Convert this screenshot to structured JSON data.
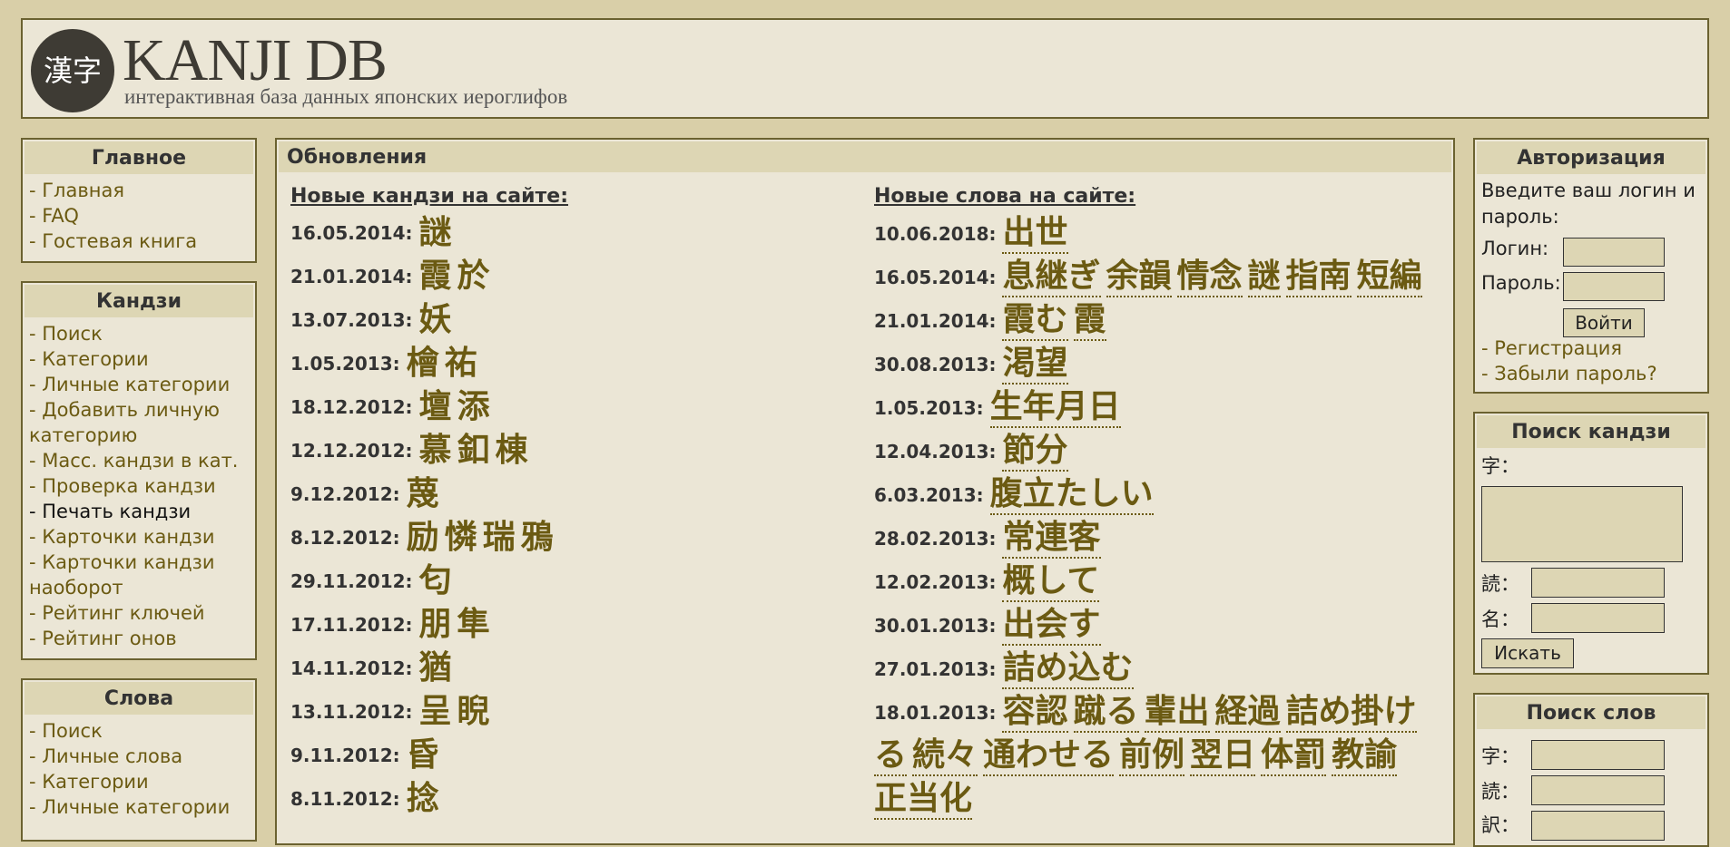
{
  "header": {
    "logo_glyph": "漢字",
    "title": "KANJI DB",
    "subtitle": "интерактивная база данных японских иероглифов"
  },
  "sidebar": {
    "main": {
      "title": "Главное",
      "items": [
        "- Главная",
        "- FAQ",
        "- Гостевая книга"
      ]
    },
    "kanji": {
      "title": "Кандзи",
      "items": [
        "- Поиск",
        "- Категории",
        "- Личные категории",
        "- Добавить личную категорию",
        "- Масс. кандзи в кат.",
        "- Проверка кандзи",
        "- Печать кандзи",
        "- Карточки кандзи",
        "- Карточки кандзи наоборот",
        "- Рейтинг ключей",
        "- Рейтинг онов"
      ]
    },
    "words": {
      "title": "Слова",
      "items": [
        "- Поиск",
        "- Личные слова",
        "- Категории",
        "- Личные категории"
      ]
    }
  },
  "main": {
    "title": "Обновления",
    "kanji_title": "Новые кандзи на сайте:",
    "words_title": "Новые слова на сайте:",
    "kanji_rows": [
      {
        "date": "16.05.2014:",
        "items": [
          "謎"
        ]
      },
      {
        "date": "21.01.2014:",
        "items": [
          "霞",
          "於"
        ]
      },
      {
        "date": "13.07.2013:",
        "items": [
          "妖"
        ]
      },
      {
        "date": "1.05.2013:",
        "items": [
          "檜",
          "祐"
        ]
      },
      {
        "date": "18.12.2012:",
        "items": [
          "壇",
          "添"
        ]
      },
      {
        "date": "12.12.2012:",
        "items": [
          "慕",
          "釦",
          "棟"
        ]
      },
      {
        "date": "9.12.2012:",
        "items": [
          "蔑"
        ]
      },
      {
        "date": "8.12.2012:",
        "items": [
          "励",
          "憐",
          "瑞",
          "鴉"
        ]
      },
      {
        "date": "29.11.2012:",
        "items": [
          "匂"
        ]
      },
      {
        "date": "17.11.2012:",
        "items": [
          "朋",
          "隼"
        ]
      },
      {
        "date": "14.11.2012:",
        "items": [
          "猶"
        ]
      },
      {
        "date": "13.11.2012:",
        "items": [
          "呈",
          "睨"
        ]
      },
      {
        "date": "9.11.2012:",
        "items": [
          "昏"
        ]
      },
      {
        "date": "8.11.2012:",
        "items": [
          "捻"
        ]
      }
    ],
    "word_rows": [
      {
        "date": "10.06.2018:",
        "items": [
          "出世"
        ]
      },
      {
        "date": "16.05.2014:",
        "items": [
          "息継ぎ",
          "余韻",
          "情念",
          "謎",
          "指南",
          "短編"
        ]
      },
      {
        "date": "21.01.2014:",
        "items": [
          "霞む",
          "霞"
        ]
      },
      {
        "date": "30.08.2013:",
        "items": [
          "渇望"
        ]
      },
      {
        "date": "1.05.2013:",
        "items": [
          "生年月日"
        ]
      },
      {
        "date": "12.04.2013:",
        "items": [
          "節分"
        ]
      },
      {
        "date": "6.03.2013:",
        "items": [
          "腹立たしい"
        ]
      },
      {
        "date": "28.02.2013:",
        "items": [
          "常連客"
        ]
      },
      {
        "date": "12.02.2013:",
        "items": [
          "概して"
        ]
      },
      {
        "date": "30.01.2013:",
        "items": [
          "出会す"
        ]
      },
      {
        "date": "27.01.2013:",
        "items": [
          "詰め込む"
        ]
      },
      {
        "date": "18.01.2013:",
        "items": [
          "容認",
          "蹴る",
          "輩出",
          "経過",
          "詰め掛け"
        ]
      },
      {
        "date": "",
        "items": [
          "る",
          "続々",
          "通わせる",
          "前例",
          "翌日",
          "体罰",
          "教諭"
        ]
      },
      {
        "date": "",
        "items": [
          "正当化"
        ]
      }
    ]
  },
  "auth": {
    "title": "Авторизация",
    "prompt": "Введите ваш логин и пароль:",
    "login_label": "Логин:",
    "password_label": "Пароль:",
    "login_button": "Войти",
    "register": "- Регистрация",
    "forgot": "- Забыли пароль?"
  },
  "kanji_search": {
    "title": "Поиск кандзи",
    "char_label": "字：",
    "reading_label": "読：",
    "name_label": "名：",
    "button": "Искать"
  },
  "word_search": {
    "title": "Поиск слов",
    "char_label": "字：",
    "reading_label": "読：",
    "third_label": "訳："
  },
  "colors": {
    "background": "#d9cfa8",
    "panel": "#ebe6d6",
    "link": "#6b5a12",
    "border": "#6b6230"
  }
}
